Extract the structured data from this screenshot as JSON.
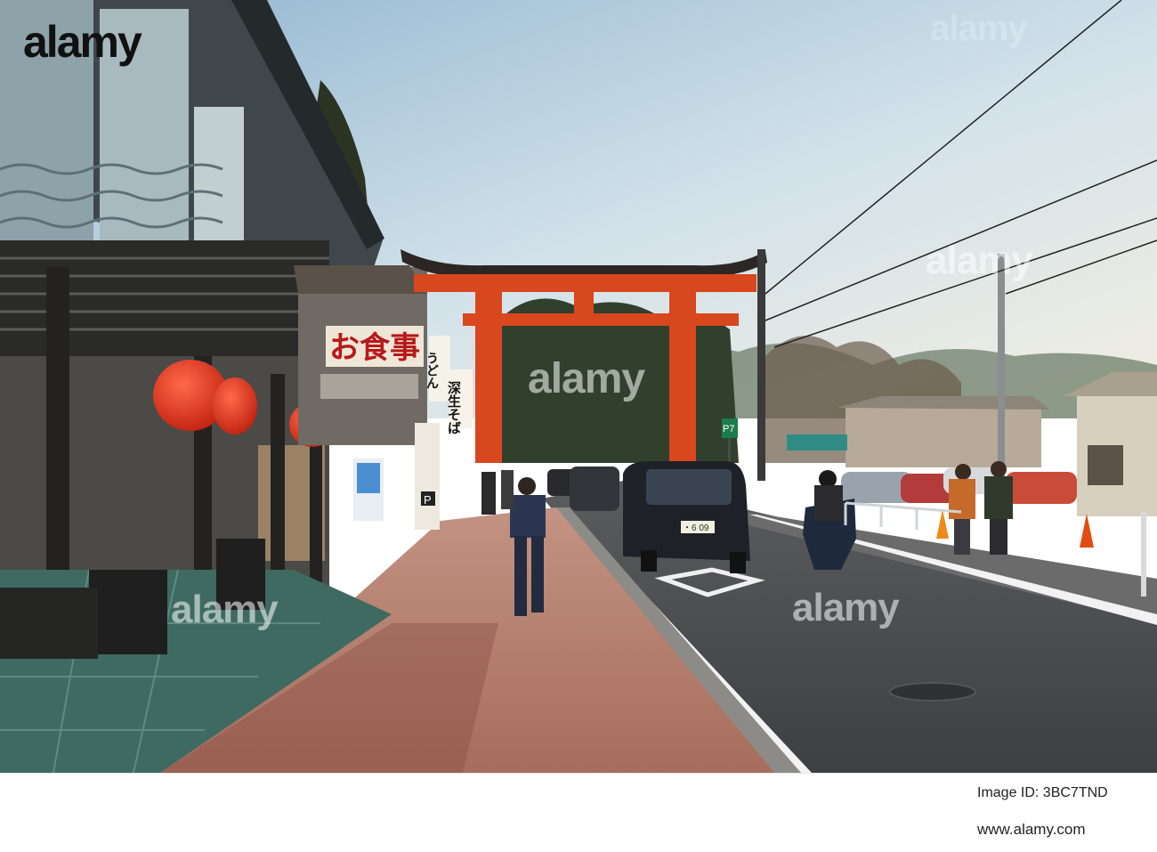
{
  "photo": {
    "kind": "street scene with red torii gate",
    "signs": {
      "restaurant_banner": "お食事",
      "vertical_sign_1": "うどん",
      "vertical_sign_2": "深生そば",
      "parking_sign": "P7",
      "small_parking_sign": "P",
      "license_plate": "・6 09"
    }
  },
  "watermarks": [
    "alamy",
    "alamy",
    "alamy",
    "alamy",
    "alamy"
  ],
  "footer": {
    "logo": "alamy",
    "image_id_label": "Image ID: 3BC7TND",
    "url": "www.alamy.com"
  },
  "colors": {
    "torii": "#d9471e",
    "lantern": "#e1301b",
    "sky": "#c9dde9",
    "road": "#45474a",
    "sidewalk": "#b97c6a"
  }
}
